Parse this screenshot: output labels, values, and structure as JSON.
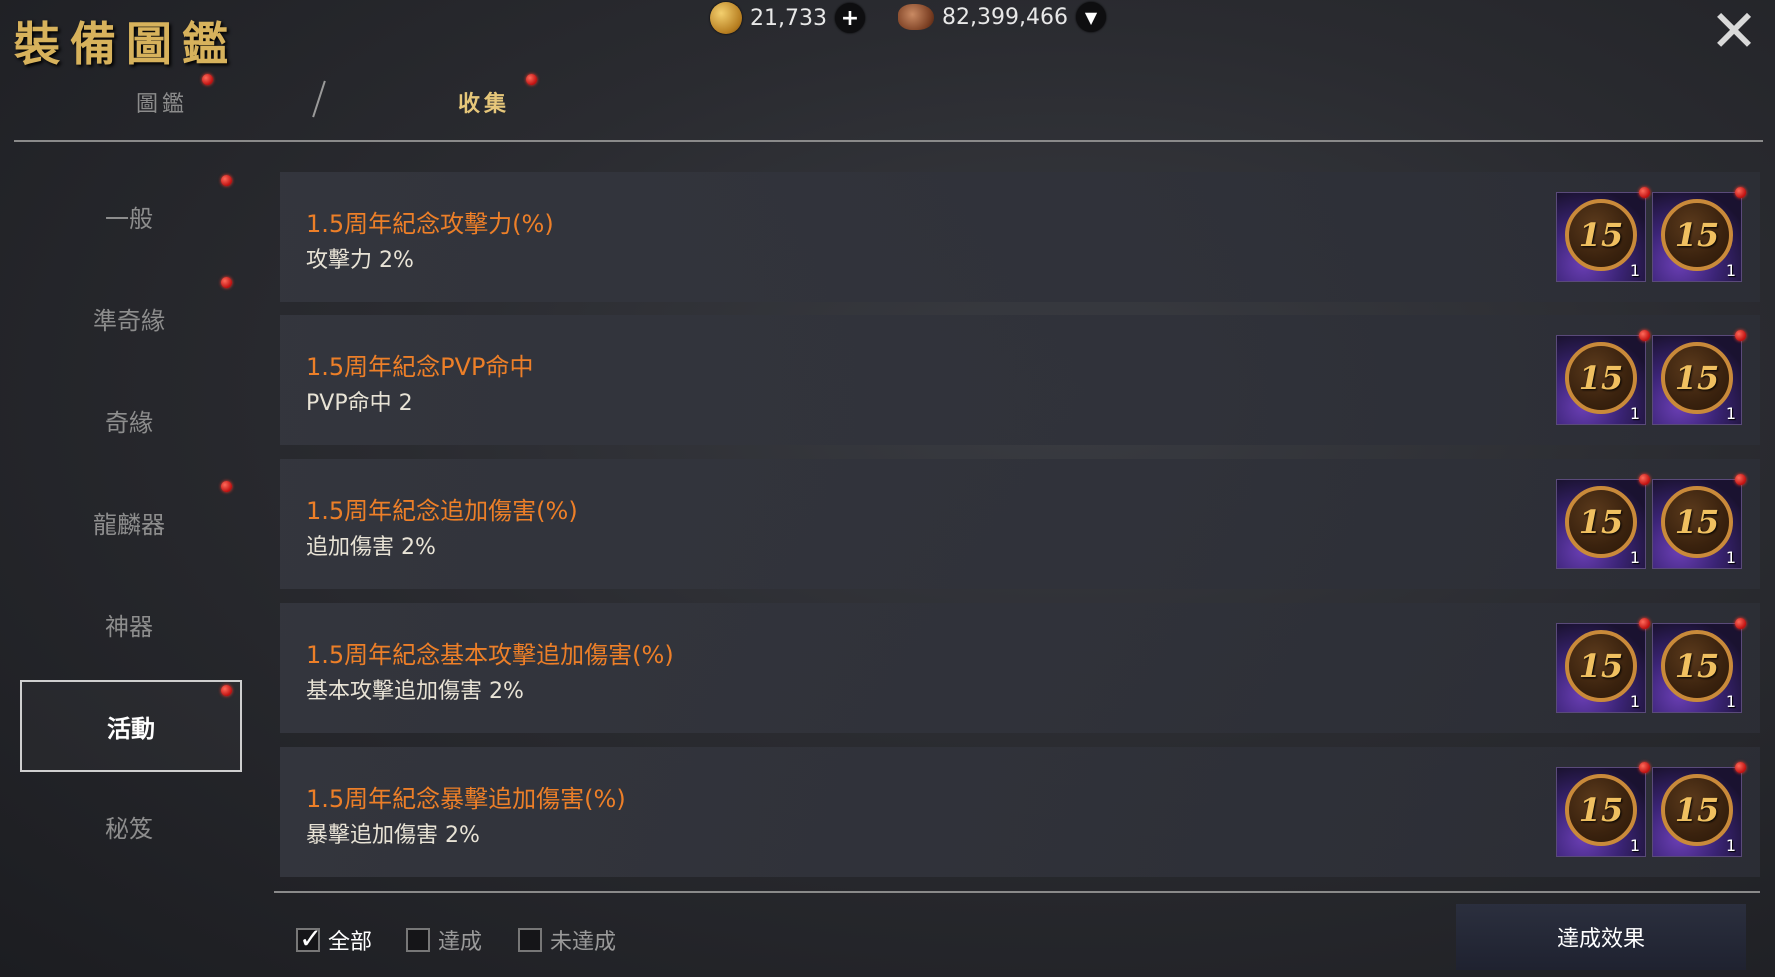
{
  "header": {
    "title": "裝備圖鑑",
    "gold": {
      "icon": "gold-coin-icon",
      "amount": "21,733"
    },
    "silver": {
      "icon": "ore-icon",
      "amount": "82,399,466"
    }
  },
  "tabs": [
    {
      "label": "圖鑑",
      "active": false
    },
    {
      "label": "收集",
      "active": true
    }
  ],
  "sidebar": {
    "items": [
      {
        "label": "一般",
        "notify": true
      },
      {
        "label": "準奇緣",
        "notify": true
      },
      {
        "label": "奇緣",
        "notify": false
      },
      {
        "label": "龍麟器",
        "notify": true
      },
      {
        "label": "神器",
        "notify": false
      },
      {
        "label": "活動",
        "notify": true,
        "active": true
      },
      {
        "label": "秘笈",
        "notify": false
      }
    ]
  },
  "collections": [
    {
      "title": "1.5周年紀念攻擊力(%)",
      "effect": "攻擊力 2%",
      "medals": [
        {
          "level": "15",
          "count": "1"
        },
        {
          "level": "15",
          "count": "1"
        }
      ]
    },
    {
      "title": "1.5周年紀念PVP命中",
      "effect": "PVP命中 2",
      "medals": [
        {
          "level": "15",
          "count": "1"
        },
        {
          "level": "15",
          "count": "1"
        }
      ]
    },
    {
      "title": "1.5周年紀念追加傷害(%)",
      "effect": "追加傷害 2%",
      "medals": [
        {
          "level": "15",
          "count": "1"
        },
        {
          "level": "15",
          "count": "1"
        }
      ]
    },
    {
      "title": "1.5周年紀念基本攻擊追加傷害(%)",
      "effect": "基本攻擊追加傷害 2%",
      "medals": [
        {
          "level": "15",
          "count": "1"
        },
        {
          "level": "15",
          "count": "1"
        }
      ]
    },
    {
      "title": "1.5周年紀念暴擊追加傷害(%)",
      "effect": "暴擊追加傷害 2%",
      "medals": [
        {
          "level": "15",
          "count": "1"
        },
        {
          "level": "15",
          "count": "1"
        }
      ]
    }
  ],
  "filters": [
    {
      "label": "全部",
      "checked": true
    },
    {
      "label": "達成",
      "checked": false
    },
    {
      "label": "未達成",
      "checked": false
    }
  ],
  "effect_button": {
    "label": "達成效果"
  },
  "colors": {
    "title_gold": "#d7b25c",
    "collection_title": "#ed7f28",
    "notify_red": "#e02020"
  }
}
